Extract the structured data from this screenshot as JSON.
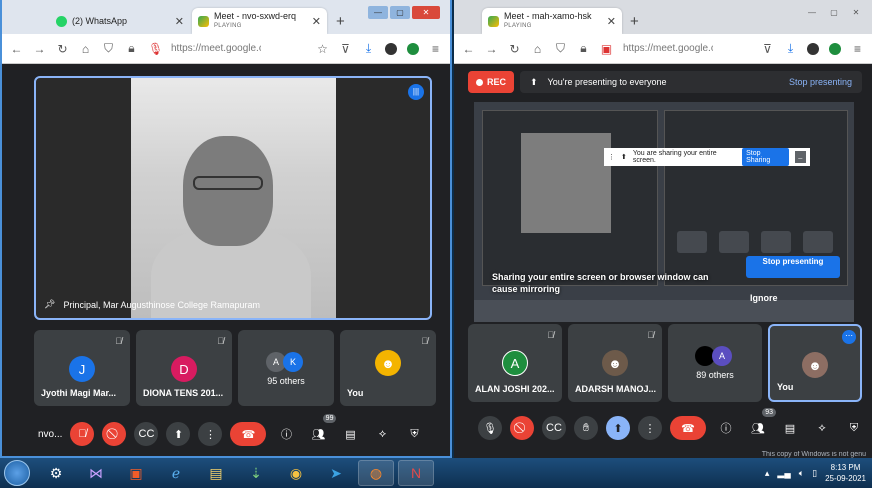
{
  "left_window": {
    "tabs": [
      {
        "title": "(2) WhatsApp",
        "subtitle": ""
      },
      {
        "title": "Meet - nvo-sxwd-erq",
        "subtitle": "PLAYING"
      }
    ],
    "url": "https://meet.google.co",
    "main_tile": {
      "name": "Principal, Mar Augusthinose College Ramapuram"
    },
    "tiles": [
      {
        "initial": "J",
        "name": "Jyothi Magi Mar...",
        "color": "#1a73e8"
      },
      {
        "initial": "D",
        "name": "DIONA TENS 201...",
        "color": "#d81b60"
      },
      {
        "initials": [
          "A",
          "K"
        ],
        "others": "95 others"
      },
      {
        "name": "You"
      }
    ],
    "meeting_code": "nvo...",
    "participants_badge": "99"
  },
  "right_window": {
    "tabs": [
      {
        "title": "Meet - mah-xamo-hsk",
        "subtitle": "PLAYING"
      }
    ],
    "url": "https://meet.google.co",
    "rec_label": "REC",
    "presenting_text": "You're presenting to everyone",
    "stop_presenting": "Stop presenting",
    "share_notice": {
      "text": "You are sharing your entire screen.",
      "button": "Stop Sharing"
    },
    "warning": "Sharing your entire screen or browser window can cause mirroring",
    "stop_button": "Stop presenting",
    "ignore": "Ignore",
    "tiles": [
      {
        "initial": "A",
        "name": "ALAN JOSHI 202...",
        "color": "#1e8e3e"
      },
      {
        "name": "ADARSH MANOJ..."
      },
      {
        "initial": "A",
        "others": "89 others",
        "color": "#5b4ec0"
      },
      {
        "name": "You"
      }
    ],
    "participants_badge": "93"
  },
  "taskbar": {
    "activation_notice": "This copy of Windows is not genu",
    "time": "8:13 PM",
    "date": "25-09-2021"
  }
}
